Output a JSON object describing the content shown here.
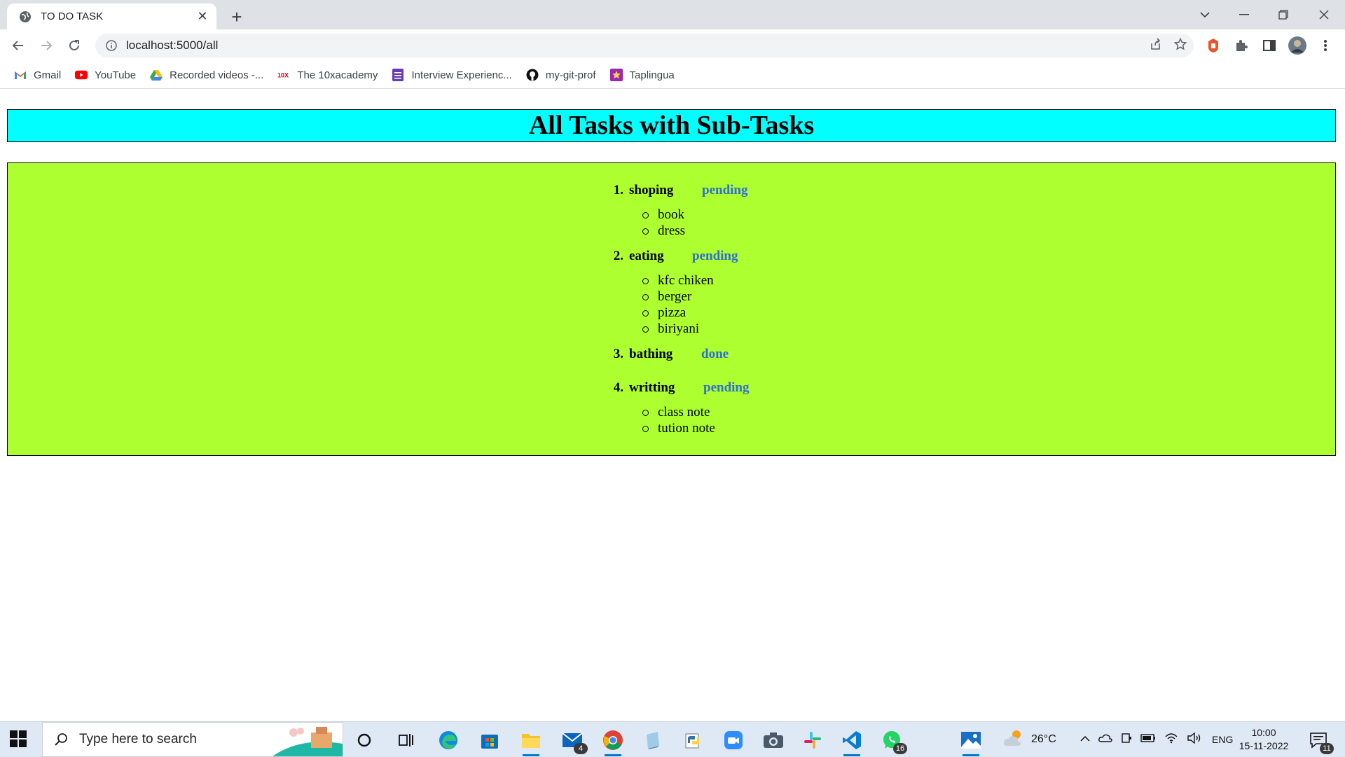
{
  "browser": {
    "tab_title": "TO DO TASK",
    "url": "localhost:5000/all",
    "bookmarks": [
      {
        "label": "Gmail",
        "icon": "gmail-icon",
        "color": "#ea4335"
      },
      {
        "label": "YouTube",
        "icon": "youtube-icon",
        "color": "#ff0000"
      },
      {
        "label": "Recorded videos -...",
        "icon": "google-drive-icon",
        "color": "#fbbc04"
      },
      {
        "label": "The 10xacademy",
        "icon": "10x-icon",
        "color": "#d0021b"
      },
      {
        "label": "Interview Experienc...",
        "icon": "form-icon",
        "color": "#673ab7"
      },
      {
        "label": "my-git-prof",
        "icon": "github-icon",
        "color": "#111111"
      },
      {
        "label": "Taplingua",
        "icon": "star-icon",
        "color": "#9c27b0"
      }
    ]
  },
  "page": {
    "title": "All Tasks with Sub-Tasks",
    "heading_color": "#00ffff",
    "panel_color": "#adff2f",
    "status_color": "#2f6fd0",
    "tasks": [
      {
        "number": "1.",
        "name": "shoping",
        "status": "pending",
        "subtasks": [
          "book",
          "dress"
        ]
      },
      {
        "number": "2.",
        "name": "eating",
        "status": "pending",
        "subtasks": [
          "kfc chiken",
          "berger",
          "pizza",
          "biriyani"
        ]
      },
      {
        "number": "3.",
        "name": "bathing",
        "status": "done",
        "subtasks": []
      },
      {
        "number": "4.",
        "name": "writting",
        "status": "pending",
        "subtasks": [
          "class note",
          "tution note"
        ]
      }
    ]
  },
  "taskbar": {
    "search_placeholder": "Type here to search",
    "apps": [
      {
        "icon": "cortana-icon"
      },
      {
        "icon": "task-view-icon"
      },
      {
        "icon": "edge-icon"
      },
      {
        "icon": "store-icon"
      },
      {
        "icon": "file-explorer-icon"
      },
      {
        "icon": "mail-icon",
        "badge": "4"
      },
      {
        "icon": "chrome-icon"
      },
      {
        "icon": "notepad-icon"
      },
      {
        "icon": "python-icon"
      },
      {
        "icon": "zoom-icon"
      },
      {
        "icon": "camera-icon"
      },
      {
        "icon": "slack-icon"
      },
      {
        "icon": "vscode-icon"
      },
      {
        "icon": "whatsapp-icon",
        "badge": "16"
      },
      {
        "icon": "photos-icon"
      }
    ],
    "weather": "26°C",
    "language": "ENG",
    "time": "10:00",
    "date": "15-11-2022",
    "notifications": "11"
  }
}
